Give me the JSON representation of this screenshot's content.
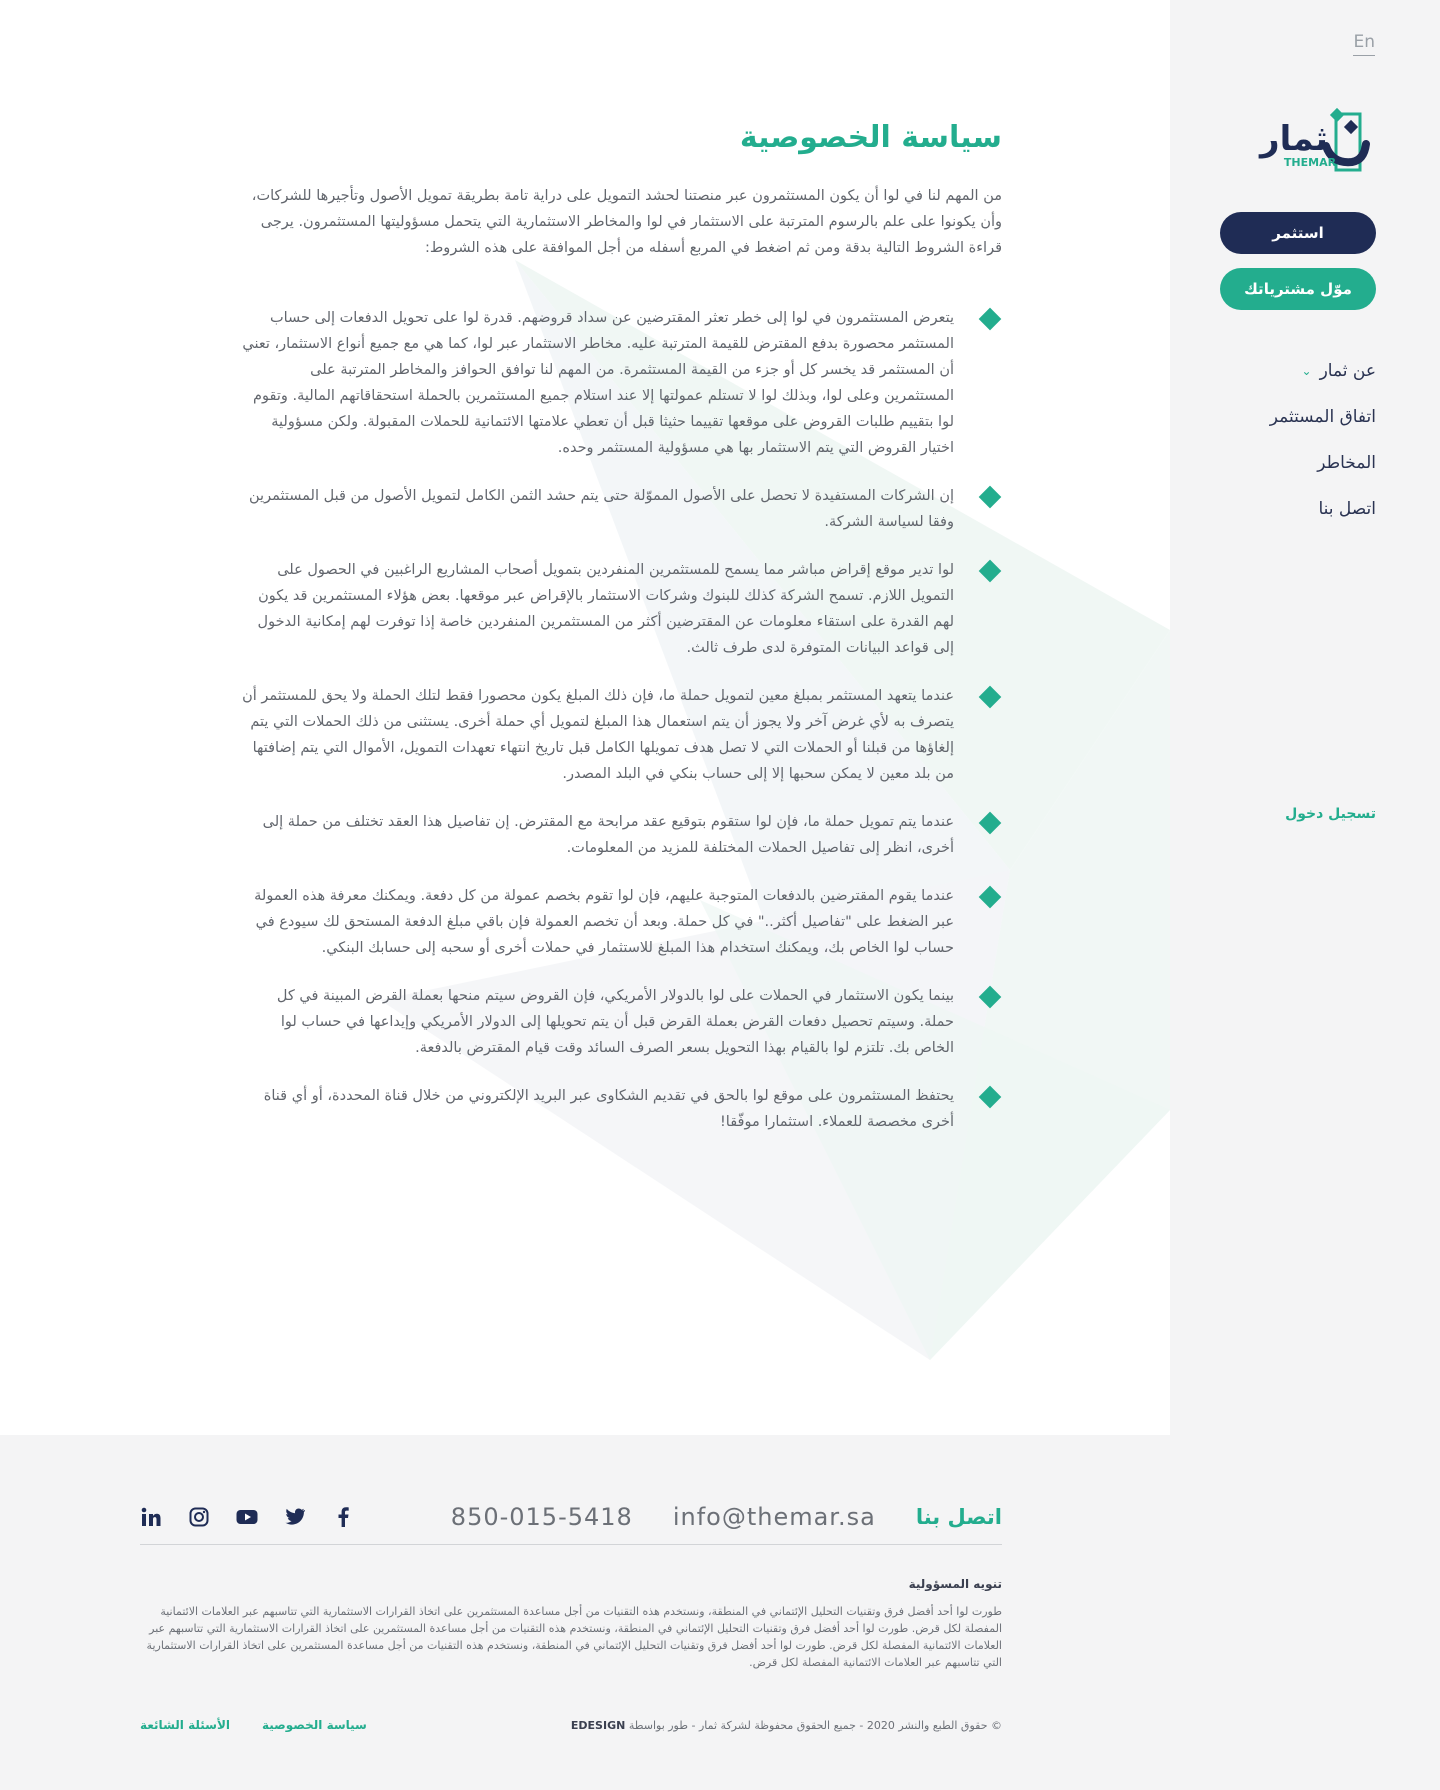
{
  "sidebar": {
    "lang": "En",
    "logo": {
      "text": "ثمار",
      "latin": "THEMAR"
    },
    "invest_btn": "استثمر",
    "fund_btn": "موّل مشترياتك",
    "nav": [
      {
        "label": "عن ثمار",
        "has_dropdown": true
      },
      {
        "label": "اتفاق المستثمر"
      },
      {
        "label": "المخاطر"
      },
      {
        "label": "اتصل بنا"
      }
    ],
    "login": "تسجيل دخول"
  },
  "main": {
    "title": "سياسة الخصوصية",
    "intro": "من المهم لنا في لوا أن يكون المستثمرون عبر منصتنا لحشد التمويل على دراية تامة بطريقة تمويل الأصول وتأجيرها للشركات، وأن يكونوا على علم بالرسوم المترتبة على الاستثمار في لوا والمخاطر الاستثمارية التي يتحمل مسؤوليتها المستثمرون. يرجى قراءة الشروط التالية بدقة ومن ثم اضغط في المربع أسفله من أجل الموافقة على هذه الشروط:",
    "terms": [
      "يتعرض المستثمرون في لوا إلى خطر تعثر المقترضين عن سداد قروضهم. قدرة لوا على تحويل الدفعات إلى حساب المستثمر محصورة بدفع المقترض للقيمة المترتبة عليه. مخاطر الاستثمار عبر لوا، كما هي مع جميع أنواع الاستثمار، تعني أن المستثمر قد يخسر كل أو جزء من القيمة المستثمرة. من المهم لنا توافق الحوافز والمخاطر المترتبة على المستثمرين وعلى لوا، وبذلك لوا لا تستلم عمولتها إلا عند استلام جميع المستثمرين بالحملة استحقاقاتهم المالية. وتقوم لوا بتقييم طلبات القروض على موقعها تقييما حثيثا قبل أن تعطي علامتها الائتمانية للحملات المقبولة. ولكن مسؤولية اختيار القروض التي يتم الاستثمار بها هي مسؤولية المستثمر وحده.",
      "إن الشركات المستفيدة لا تحصل على الأصول المموّلة حتى يتم حشد الثمن الكامل لتمويل الأصول من قبل المستثمرين وفقا لسياسة الشركة.",
      "لوا تدير موقع إقراض مباشر مما يسمح للمستثمرين المنفردين بتمويل أصحاب المشاريع الراغبين في الحصول على التمويل اللازم. تسمح الشركة كذلك للبنوك وشركات الاستثمار بالإقراض عبر موقعها. بعض هؤلاء المستثمرين قد يكون لهم القدرة على استقاء معلومات عن المقترضين أكثر من المستثمرين المنفردين خاصة إذا توفرت لهم إمكانية الدخول إلى قواعد البيانات المتوفرة لدى طرف ثالث.",
      "عندما يتعهد المستثمر بمبلغ معين لتمويل حملة ما، فإن ذلك المبلغ يكون محصورا فقط لتلك الحملة ولا يحق للمستثمر أن يتصرف به لأي غرض آخر ولا يجوز أن يتم استعمال هذا المبلغ لتمويل أي حملة أخرى. يستثنى من ذلك الحملات التي يتم إلغاؤها من قبلنا أو الحملات التي لا تصل هدف تمويلها الكامل قبل تاريخ انتهاء تعهدات التمويل، الأموال التي يتم إضافتها من بلد معين لا يمكن سحبها إلا إلى حساب بنكي في البلد المصدر.",
      "عندما يتم تمويل حملة ما، فإن لوا ستقوم بتوقيع عقد مرابحة مع المقترض. إن تفاصيل هذا العقد تختلف من حملة إلى أخرى، انظر إلى تفاصيل الحملات المختلفة للمزيد من المعلومات.",
      "عندما يقوم المقترضين بالدفعات المتوجبة عليهم، فإن لوا تقوم بخصم عمولة من كل دفعة. ويمكنك معرفة هذه العمولة عبر الضغط على \"تفاصيل أكثر..\" في كل حملة. وبعد أن تخصم العمولة فإن باقي مبلغ الدفعة المستحق لك سيودع في حساب لوا الخاص بك، ويمكنك استخدام هذا المبلغ للاستثمار في حملات أخرى أو سحبه إلى حسابك البنكي.",
      "بينما يكون الاستثمار في الحملات على لوا بالدولار الأمريكي، فإن القروض سيتم منحها بعملة القرض المبينة في كل حملة. وسيتم تحصيل دفعات القرض بعملة القرض قبل أن يتم تحويلها إلى الدولار الأمريكي وإيداعها في حساب لوا الخاص بك. تلتزم لوا بالقيام بهذا التحويل بسعر الصرف السائد وقت قيام المقترض بالدفعة.",
      "يحتفظ المستثمرون على موقع لوا بالحق في تقديم الشكاوى عبر البريد الإلكتروني من خلال قناة المحددة، أو أي قناة أخرى مخصصة للعملاء. استثمارا موفّقا!"
    ]
  },
  "footer": {
    "contact_title": "اتصل بنا",
    "email": "info@themar.sa",
    "phone": "850-015-5418",
    "socials": [
      "linkedin-icon",
      "instagram-icon",
      "youtube-icon",
      "twitter-icon",
      "facebook-icon"
    ],
    "disclaimer_title": "تنويه المسؤولية",
    "disclaimer": "طورت لوا أحد أفضل فرق وتقنيات التحليل الإئتماني في المنطقة، ونستخدم هذه التقنيات من أجل مساعدة المستثمرين على اتخاذ القرارات الاستثمارية التي تتاسبهم عبر العلامات الائتمانية المفصلة لكل قرض. طورت لوا أحد أفضل فرق وتقنيات التحليل الإئتماني في المنطقة، ونستخدم هذه التقنيات من أجل مساعدة المستثمرين على اتخاذ القرارات الاستثمارية التي تتاسبهم عبر العلامات الائتمانية المفصلة لكل قرض. طورت لوا أحد أفضل فرق وتقنيات التحليل الإئتماني في المنطقة، ونستخدم هذه التقنيات من أجل مساعدة المستثمرين على اتخاذ القرارات الاستثمارية التي تتاسبهم عبر العلامات الائتمانية المفصلة لكل قرض.",
    "copyright": "© حقوق الطبع والنشر 2020 - جميع الحقوق محفوظة لشركة ثمار - طور بواسطة",
    "designer": "EDESIGN",
    "links": [
      "الأسئلة الشائعة",
      "سياسة الخصوصية"
    ]
  },
  "colors": {
    "accent": "#23ad8e",
    "navy": "#1f2c55",
    "sidebar_bg": "#f4f4f5"
  }
}
